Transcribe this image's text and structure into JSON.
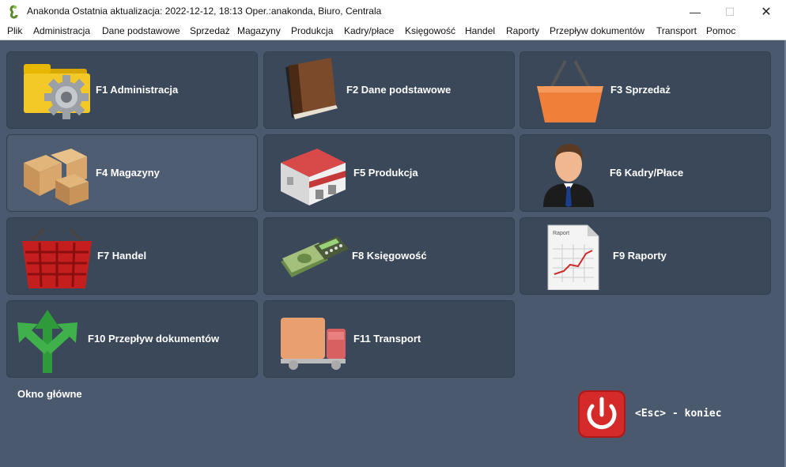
{
  "window": {
    "title": "Anakonda Ostatnia aktualizacja: 2022-12-12, 18:13 Oper.:anakonda, Biuro, Centrala",
    "minimize": "—",
    "maximize": "☐",
    "close": "✕"
  },
  "menu": [
    "Plik",
    "Administracja",
    "Dane podstawowe",
    "Sprzedaż",
    "Magazyny",
    "Produkcja",
    "Kadry/płace",
    "Księgowość",
    "Handel",
    "Raporty",
    "Przepływ dokumentów",
    "Transport",
    "Pomoc"
  ],
  "tiles": [
    {
      "label": "F1  Administracja",
      "icon": "gear-folder-icon"
    },
    {
      "label": "F2  Dane podstawowe",
      "icon": "book-icon"
    },
    {
      "label": "F3  Sprzedaż",
      "icon": "shopping-basket-icon"
    },
    {
      "label": "F4  Magazyny",
      "icon": "boxes-icon"
    },
    {
      "label": "F5  Produkcja",
      "icon": "factory-icon"
    },
    {
      "label": "F6  Kadry/Płace",
      "icon": "person-icon"
    },
    {
      "label": "F7  Handel",
      "icon": "red-basket-icon"
    },
    {
      "label": "F8  Księgowość",
      "icon": "money-calculator-icon"
    },
    {
      "label": "F9  Raporty",
      "icon": "report-icon"
    },
    {
      "label": "F10  Przepływ dokumentów",
      "icon": "arrows-icon"
    },
    {
      "label": "F11  Transport",
      "icon": "truck-icon"
    }
  ],
  "report_icon_text": "Raport",
  "footer": {
    "title": "Okno główne",
    "exit_label": "<Esc> - koniec"
  },
  "colors": {
    "background": "#4a596e",
    "tile": "#3a4859",
    "tile_active": "#4e5d71",
    "exit_red": "#d42a2a"
  }
}
